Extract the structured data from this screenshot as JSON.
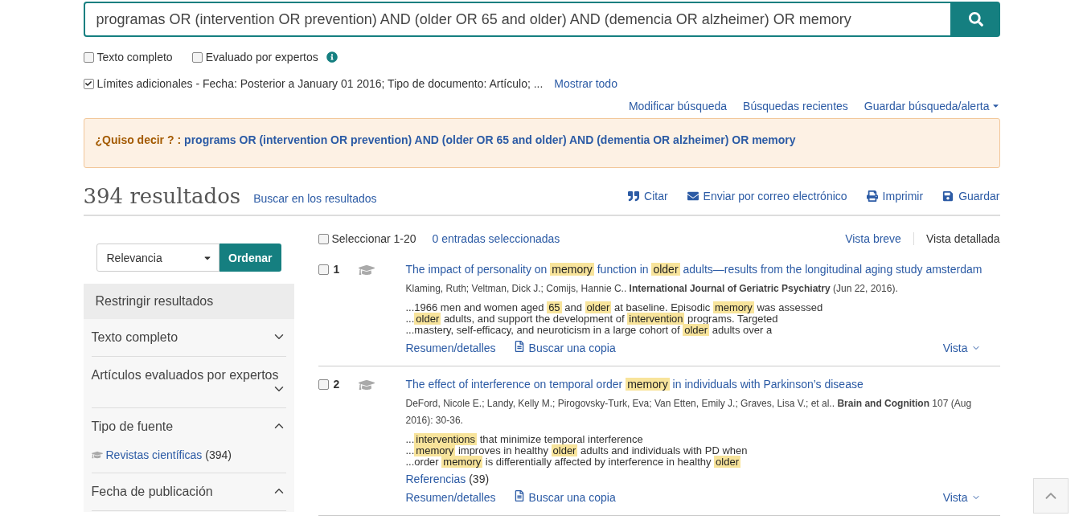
{
  "search": {
    "query": "programas OR (intervention OR prevention) AND (older OR 65 and older) AND (demencia OR alzheimer) OR memory"
  },
  "options": [
    {
      "label": "Texto completo",
      "checked": false,
      "info": false
    },
    {
      "label": "Evaluado por expertos",
      "checked": false,
      "info": true
    }
  ],
  "limits": {
    "checked": true,
    "label": "Límites adicionales - Fecha: Posterior a January 01 2016; Tipo de documento: Artículo; ...",
    "link": "Mostrar todo"
  },
  "search_links": [
    {
      "label": "Modificar búsqueda",
      "dropdown": false
    },
    {
      "label": "Búsquedas recientes",
      "dropdown": false
    },
    {
      "label": "Guardar búsqueda/alerta",
      "dropdown": true
    }
  ],
  "suggestion": {
    "prompt": "¿Quiso decir ? :",
    "query": "programs OR (intervention OR prevention) AND (older OR 65 and older) AND (dementia OR alzheimer) OR memory"
  },
  "results_header": {
    "count": "394 resultados",
    "search_within": "Buscar en los resultados",
    "actions": [
      {
        "kind": "quote",
        "label": "Citar"
      },
      {
        "kind": "mail",
        "label": "Enviar por correo electrónico"
      },
      {
        "kind": "print",
        "label": "Imprimir"
      },
      {
        "kind": "save",
        "label": "Guardar"
      }
    ]
  },
  "sort": {
    "value": "Relevancia",
    "button": "Ordenar"
  },
  "refine": {
    "title": "Restringir resultados",
    "facets": [
      {
        "label": "Texto completo",
        "expanded": false
      },
      {
        "label": "Artículos evaluados por expertos",
        "expanded": false
      },
      {
        "label": "Tipo de fuente",
        "expanded": true,
        "items": [
          {
            "label": "Revistas científicas",
            "count": "(394)"
          }
        ]
      },
      {
        "label": "Fecha de publicación",
        "expanded": true
      }
    ]
  },
  "list_toolbar": {
    "select_label": "Seleccionar 1-20",
    "select_checked": false,
    "selected_count": "0 entradas seleccionadas",
    "views": [
      {
        "label": "Vista breve",
        "selected": false
      },
      {
        "label": "Vista detallada",
        "selected": true
      }
    ]
  },
  "results": [
    {
      "number": "1",
      "checked": false,
      "title": [
        {
          "text": "The impact of personality on ",
          "hl": false
        },
        {
          "text": "memory",
          "hl": true
        },
        {
          "text": " function in ",
          "hl": false
        },
        {
          "text": "older",
          "hl": true
        },
        {
          "text": " adults—results from the longitudinal aging study amsterdam",
          "hl": false
        }
      ],
      "citation": "Klaming, Ruth; Veltman, Dick J.; Comijs, Hannie C.. **International Journal of Geriatric Psychiatry** (Jun 22, 2016).",
      "snippets": [
        [
          {
            "text": "...1966 men and women aged ",
            "hl": false
          },
          {
            "text": "65",
            "hl": true
          },
          {
            "text": " and ",
            "hl": false
          },
          {
            "text": "older",
            "hl": true
          },
          {
            "text": " at baseline. Episodic ",
            "hl": false
          },
          {
            "text": "memory",
            "hl": true
          },
          {
            "text": " was assessed",
            "hl": false
          }
        ],
        [
          {
            "text": "...",
            "hl": false
          },
          {
            "text": "older",
            "hl": true
          },
          {
            "text": " adults, and support the development of ",
            "hl": false
          },
          {
            "text": "intervention",
            "hl": true
          },
          {
            "text": " programs. Targeted",
            "hl": false
          }
        ],
        [
          {
            "text": "...mastery, self-efficacy, and neuroticism in a large cohort of ",
            "hl": false
          },
          {
            "text": "older",
            "hl": true
          },
          {
            "text": " adults over a",
            "hl": false
          }
        ]
      ],
      "links": {
        "details": "Resumen/detalles",
        "copy": "Buscar una copia",
        "view": "Vista"
      }
    },
    {
      "number": "2",
      "checked": false,
      "title": [
        {
          "text": "The effect of interference on temporal order ",
          "hl": false
        },
        {
          "text": "memory",
          "hl": true
        },
        {
          "text": " in individuals with Parkinson’s disease",
          "hl": false
        }
      ],
      "citation": "DeFord, Nicole E.; Landy, Kelly M.; Pirogovsky-Turk, Eva; Van Etten, Emily J.; Graves, Lisa V.; et al.. **Brain and Cognition** 107  (Aug 2016): 30-36.",
      "snippets": [
        [
          {
            "text": "...",
            "hl": false
          },
          {
            "text": "interventions",
            "hl": true
          },
          {
            "text": " that minimize temporal interference",
            "hl": false
          }
        ],
        [
          {
            "text": "...",
            "hl": false
          },
          {
            "text": "memory",
            "hl": true
          },
          {
            "text": " improves in healthy ",
            "hl": false
          },
          {
            "text": "older",
            "hl": true
          },
          {
            "text": " adults and individuals with PD when",
            "hl": false
          }
        ],
        [
          {
            "text": "...order ",
            "hl": false
          },
          {
            "text": "memory",
            "hl": true
          },
          {
            "text": " is differentially affected by interference in healthy ",
            "hl": false
          },
          {
            "text": "older",
            "hl": true
          }
        ]
      ],
      "references": {
        "label": "Referencias",
        "count": "(39)"
      },
      "links": {
        "details": "Resumen/detalles",
        "copy": "Buscar una copia",
        "view": "Vista"
      }
    }
  ]
}
